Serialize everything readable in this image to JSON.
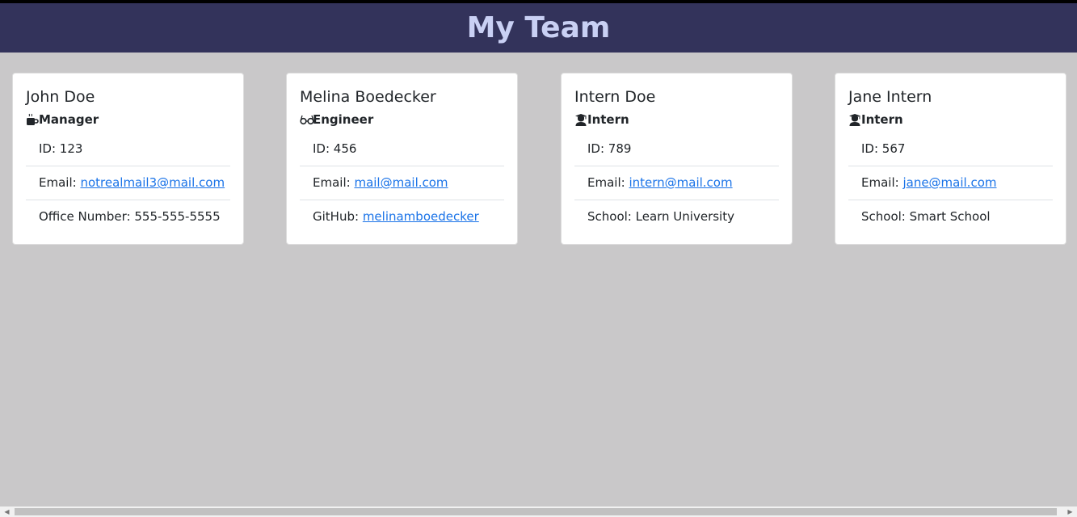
{
  "header": {
    "title": "My Team"
  },
  "cards": [
    {
      "name": "John Doe",
      "role": "Manager",
      "role_icon": "coffee-icon",
      "id_line": "ID: 123",
      "email_label": "Email: ",
      "email": "notrealmail3@mail.com",
      "extra_label": "Office Number: 555-555-5555",
      "extra_link": ""
    },
    {
      "name": "Melina Boedecker",
      "role": "Engineer",
      "role_icon": "glasses-icon",
      "id_line": "ID: 456",
      "email_label": "Email: ",
      "email": "mail@mail.com",
      "extra_label": "GitHub: ",
      "extra_link": "melinamboedecker"
    },
    {
      "name": "Intern Doe",
      "role": "Intern",
      "role_icon": "graduate-icon",
      "id_line": "ID: 789",
      "email_label": "Email: ",
      "email": "intern@mail.com",
      "extra_label": "School: Learn University",
      "extra_link": ""
    },
    {
      "name": "Jane Intern",
      "role": "Intern",
      "role_icon": "graduate-icon",
      "id_line": "ID: 567",
      "email_label": "Email: ",
      "email": "jane@mail.com",
      "extra_label": "School: Smart School",
      "extra_link": ""
    }
  ],
  "colors": {
    "header_bg": "#33335b",
    "header_text": "#c9d0f4",
    "page_bg": "#c9c8c9",
    "link": "#1a73e8"
  }
}
